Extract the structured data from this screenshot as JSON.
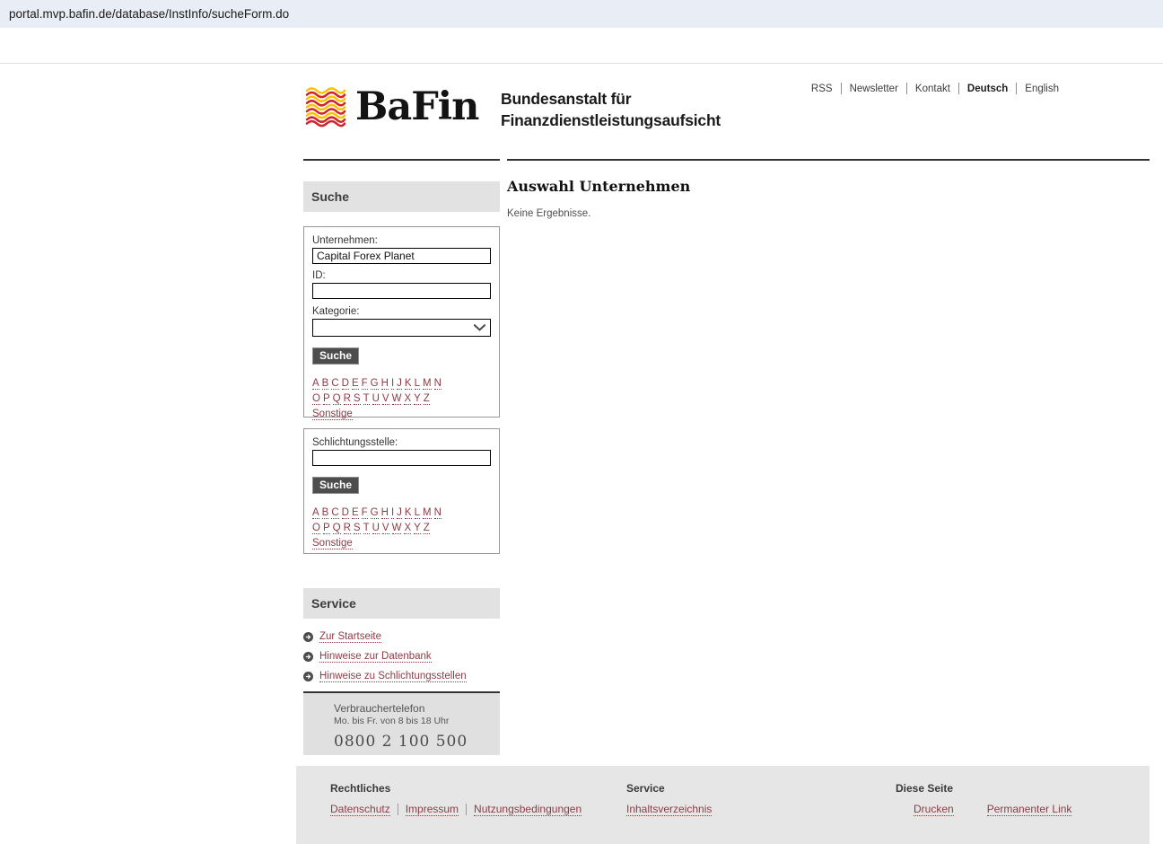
{
  "browser": {
    "url": "portal.mvp.bafin.de/database/InstInfo/sucheForm.do"
  },
  "header": {
    "logo_text": "BaFin",
    "org_line1": "Bundesanstalt für",
    "org_line2": "Finanzdienstleistungsaufsicht",
    "nav": [
      "RSS",
      "Newsletter",
      "Kontakt",
      "Deutsch",
      "English"
    ]
  },
  "sidebar": {
    "search_header": "Suche",
    "company_search": {
      "company_label": "Unternehmen:",
      "company_value": "Capital Forex Planet",
      "id_label": "ID:",
      "id_value": "",
      "category_label": "Kategorie:",
      "category_value": "",
      "submit_label": "Suche",
      "alphabet_row1": [
        "A",
        "B",
        "C",
        "D",
        "E",
        "F",
        "G",
        "H",
        "I",
        "J",
        "K",
        "L",
        "M",
        "N"
      ],
      "alphabet_row2": [
        "O",
        "P",
        "Q",
        "R",
        "S",
        "T",
        "U",
        "V",
        "W",
        "X",
        "Y",
        "Z"
      ],
      "other_label": "Sonstige"
    },
    "arbitration_search": {
      "label": "Schlichtungsstelle:",
      "value": "",
      "submit_label": "Suche",
      "alphabet_row1": [
        "A",
        "B",
        "C",
        "D",
        "E",
        "F",
        "G",
        "H",
        "I",
        "J",
        "K",
        "L",
        "M",
        "N"
      ],
      "alphabet_row2": [
        "O",
        "P",
        "Q",
        "R",
        "S",
        "T",
        "U",
        "V",
        "W",
        "X",
        "Y",
        "Z"
      ],
      "other_label": "Sonstige"
    },
    "service_header": "Service",
    "service_links": [
      "Zur Startseite",
      "Hinweise zur Datenbank",
      "Hinweise zu Schlichtungsstellen"
    ],
    "phone_box": {
      "title": "Verbrauchertelefon",
      "hours": "Mo. bis Fr. von 8 bis 18 Uhr",
      "number": "0800 2 100 500"
    }
  },
  "main": {
    "title": "Auswahl Unternehmen",
    "empty_message": "Keine Ergebnisse."
  },
  "footer": {
    "columns": [
      {
        "heading": "Rechtliches",
        "links": [
          "Datenschutz",
          "Impressum",
          "Nutzungsbedingungen"
        ]
      },
      {
        "heading": "Service",
        "links": [
          "Inhaltsverzeichnis"
        ]
      },
      {
        "heading": "Diese Seite",
        "links": [
          "Drucken",
          "Permanenter Link"
        ]
      }
    ]
  },
  "colors": {
    "link": "#8d3c46",
    "logo_red": "#d2232a",
    "logo_yellow": "#fcc200",
    "button_bg": "#4d4d4d",
    "urlbar_bg": "#e9edf6"
  }
}
